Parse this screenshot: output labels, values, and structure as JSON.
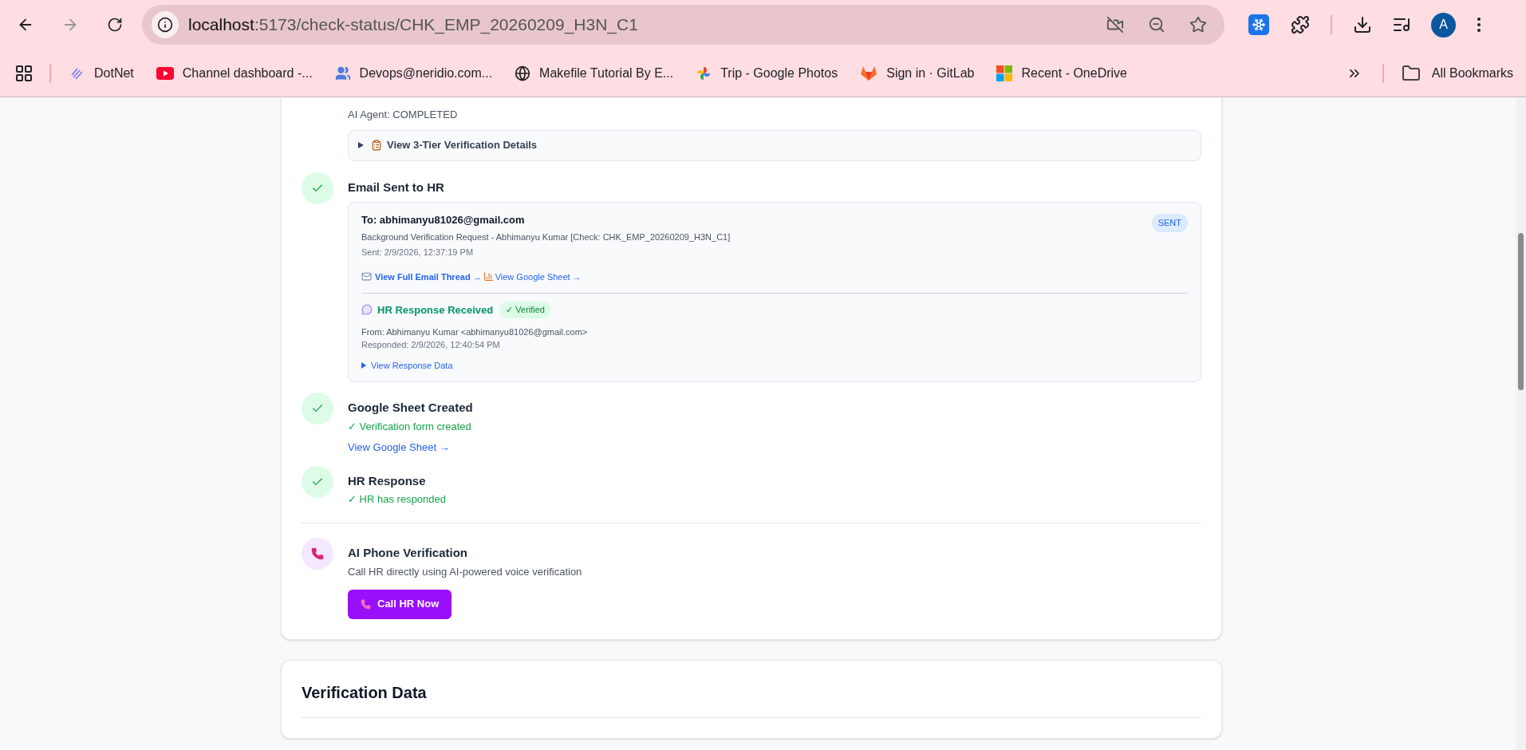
{
  "browser": {
    "url": {
      "host": "localhost",
      "path": ":5173/check-status/CHK_EMP_20260209_H3N_C1"
    },
    "avatar": "A",
    "bookmarks": [
      {
        "label": "DotNet",
        "kind": "dotnet"
      },
      {
        "label": "Channel dashboard -...",
        "kind": "youtube"
      },
      {
        "label": "Devops@neridio.com...",
        "kind": "people"
      },
      {
        "label": "Makefile Tutorial By E...",
        "kind": "globe"
      },
      {
        "label": "Trip - Google Photos",
        "kind": "photos"
      },
      {
        "label": "Sign in · GitLab",
        "kind": "gitlab"
      },
      {
        "label": "Recent - OneDrive",
        "kind": "windows"
      }
    ],
    "all_bookmarks": "All Bookmarks"
  },
  "progress_card": {
    "previous_step": {
      "agent_line": "AI Agent: COMPLETED",
      "details_summary": "View 3-Tier Verification Details",
      "expanded": false
    },
    "steps": [
      {
        "kind": "email",
        "done": true,
        "title": "Email Sent to HR",
        "email": {
          "to": "To: abhimanyu81026@gmail.com",
          "subject": "Background Verification Request - Abhimanyu Kumar [Check: CHK_EMP_20260209_H3N_C1]",
          "sent": "Sent: 2/9/2026, 12:37:19 PM",
          "badge": "SENT",
          "thread_link": "View Full Email Thread →",
          "sheet_link": "View Google Sheet →",
          "response": {
            "title": "HR Response Received",
            "badge": "✓ Verified",
            "from": "From: Abhimanyu Kumar <abhimanyu81026@gmail.com>",
            "responded": "Responded: 2/9/2026, 12:40:54 PM",
            "toggle": "View Response Data",
            "expanded": false
          }
        }
      },
      {
        "kind": "simple",
        "done": true,
        "title": "Google Sheet Created",
        "note": "✓ Verification form created",
        "link": "View Google Sheet →"
      },
      {
        "kind": "simple",
        "done": true,
        "title": "HR Response",
        "note": "✓ HR has responded"
      },
      {
        "kind": "action",
        "title": "AI Phone Verification",
        "description": "Call HR directly using AI-powered voice verification",
        "button": "Call HR Now"
      }
    ]
  },
  "data_card": {
    "title": "Verification Data"
  }
}
